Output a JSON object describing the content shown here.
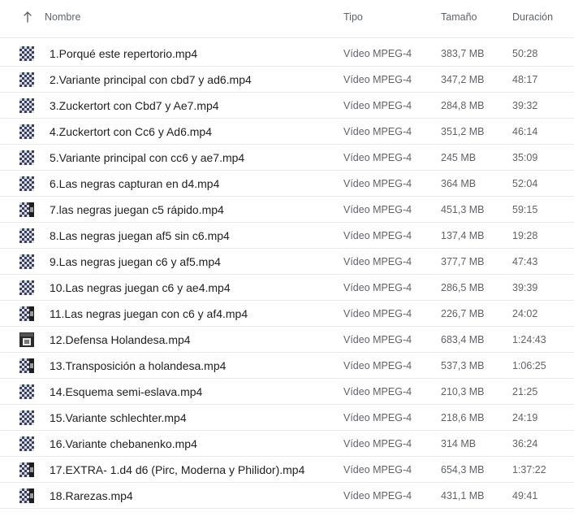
{
  "header": {
    "name": "Nombre",
    "type": "Tipo",
    "size": "Tamaño",
    "duration": "Duración",
    "sort_icon": "arrow-up-icon"
  },
  "files": [
    {
      "name": "1.Porqué este repertorio.mp4",
      "type": "Vídeo MPEG-4",
      "size": "383,7 MB",
      "duration": "50:28",
      "thumb": "chessboard"
    },
    {
      "name": "2.Variante principal con cbd7 y ad6.mp4",
      "type": "Vídeo MPEG-4",
      "size": "347,2 MB",
      "duration": "48:17",
      "thumb": "chessboard"
    },
    {
      "name": "3.Zuckertort con Cbd7 y Ae7.mp4",
      "type": "Vídeo MPEG-4",
      "size": "284,8 MB",
      "duration": "39:32",
      "thumb": "chessboard"
    },
    {
      "name": "4.Zuckertort con Cc6 y Ad6.mp4",
      "type": "Vídeo MPEG-4",
      "size": "351,2 MB",
      "duration": "46:14",
      "thumb": "chessboard"
    },
    {
      "name": "5.Variante principal con cc6 y ae7.mp4",
      "type": "Vídeo MPEG-4",
      "size": "245 MB",
      "duration": "35:09",
      "thumb": "chessboard"
    },
    {
      "name": "6.Las negras capturan en d4.mp4",
      "type": "Vídeo MPEG-4",
      "size": "364 MB",
      "duration": "52:04",
      "thumb": "chessboard"
    },
    {
      "name": "7.las negras juegan c5 rápido.mp4",
      "type": "Vídeo MPEG-4",
      "size": "451,3 MB",
      "duration": "59:15",
      "thumb": "chessboard-dark"
    },
    {
      "name": "8.Las negras juegan af5 sin c6.mp4",
      "type": "Vídeo MPEG-4",
      "size": "137,4 MB",
      "duration": "19:28",
      "thumb": "chessboard"
    },
    {
      "name": "9.Las negras juegan c6 y af5.mp4",
      "type": "Vídeo MPEG-4",
      "size": "377,7 MB",
      "duration": "47:43",
      "thumb": "chessboard"
    },
    {
      "name": "10.Las negras juegan c6 y ae4.mp4",
      "type": "Vídeo MPEG-4",
      "size": "286,5 MB",
      "duration": "39:39",
      "thumb": "chessboard"
    },
    {
      "name": "11.Las negras juegan con c6 y af4.mp4",
      "type": "Vídeo MPEG-4",
      "size": "226,7 MB",
      "duration": "24:02",
      "thumb": "chessboard-dark"
    },
    {
      "name": "12.Defensa Holandesa.mp4",
      "type": "Vídeo MPEG-4",
      "size": "683,4 MB",
      "duration": "1:24:43",
      "thumb": "screen-dark"
    },
    {
      "name": "13.Transposición a holandesa.mp4",
      "type": "Vídeo MPEG-4",
      "size": "537,3 MB",
      "duration": "1:06:25",
      "thumb": "chessboard-dark"
    },
    {
      "name": "14.Esquema semi-eslava.mp4",
      "type": "Vídeo MPEG-4",
      "size": "210,3 MB",
      "duration": "21:25",
      "thumb": "chessboard"
    },
    {
      "name": "15.Variante schlechter.mp4",
      "type": "Vídeo MPEG-4",
      "size": "218,6 MB",
      "duration": "24:19",
      "thumb": "chessboard"
    },
    {
      "name": "16.Variante chebanenko.mp4",
      "type": "Vídeo MPEG-4",
      "size": "314 MB",
      "duration": "36:24",
      "thumb": "chessboard"
    },
    {
      "name": "17.EXTRA- 1.d4 d6 (Pirc, Moderna y Philidor).mp4",
      "type": "Vídeo MPEG-4",
      "size": "654,3 MB",
      "duration": "1:37:22",
      "thumb": "chessboard-dark"
    },
    {
      "name": "18.Rarezas.mp4",
      "type": "Vídeo MPEG-4",
      "size": "431,1 MB",
      "duration": "49:41",
      "thumb": "chessboard-dark"
    }
  ]
}
